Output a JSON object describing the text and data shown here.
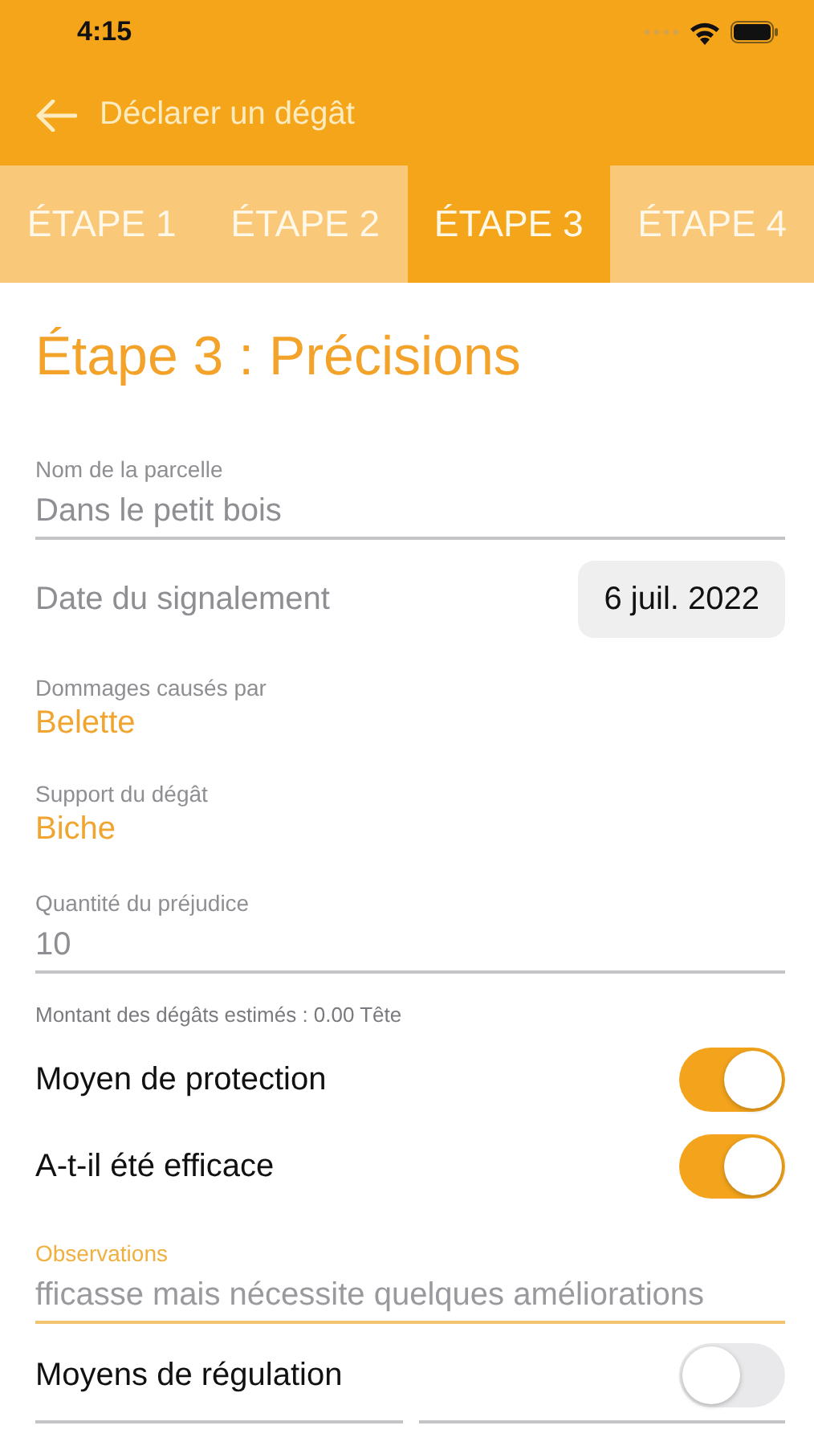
{
  "status_bar": {
    "time": "4:15"
  },
  "nav": {
    "title": "Déclarer un dégât"
  },
  "tabs": [
    {
      "label": "ÉTAPE 1",
      "selected": false
    },
    {
      "label": "ÉTAPE 2",
      "selected": false
    },
    {
      "label": "ÉTAPE 3",
      "selected": true
    },
    {
      "label": "ÉTAPE 4",
      "selected": false
    }
  ],
  "heading": "Étape 3 : Précisions",
  "fields": [
    {
      "kind": "text",
      "label": "Nom de la parcelle",
      "value": "Dans le petit bois",
      "focused": false
    },
    {
      "kind": "date",
      "label": "Date du signalement",
      "value": "6 juil. 2022"
    },
    {
      "kind": "picker",
      "label": "Dommages causés par",
      "value": "Belette"
    },
    {
      "kind": "picker",
      "label": "Support du dégât",
      "value": "Biche"
    },
    {
      "kind": "text",
      "label": "Quantité du préjudice",
      "value": "10",
      "focused": false
    },
    {
      "kind": "note",
      "label": "Montant des dégâts estimés : 0.00 Tête"
    },
    {
      "kind": "toggle",
      "label": "Moyen de protection",
      "on": true
    },
    {
      "kind": "toggle",
      "label": "A-t-il été efficace",
      "on": true
    },
    {
      "kind": "text",
      "label": "Observations",
      "value": "fficasse mais nécessite quelques améliorations",
      "focused": true
    },
    {
      "kind": "toggle",
      "label": "Moyens de régulation",
      "on": false
    }
  ]
}
